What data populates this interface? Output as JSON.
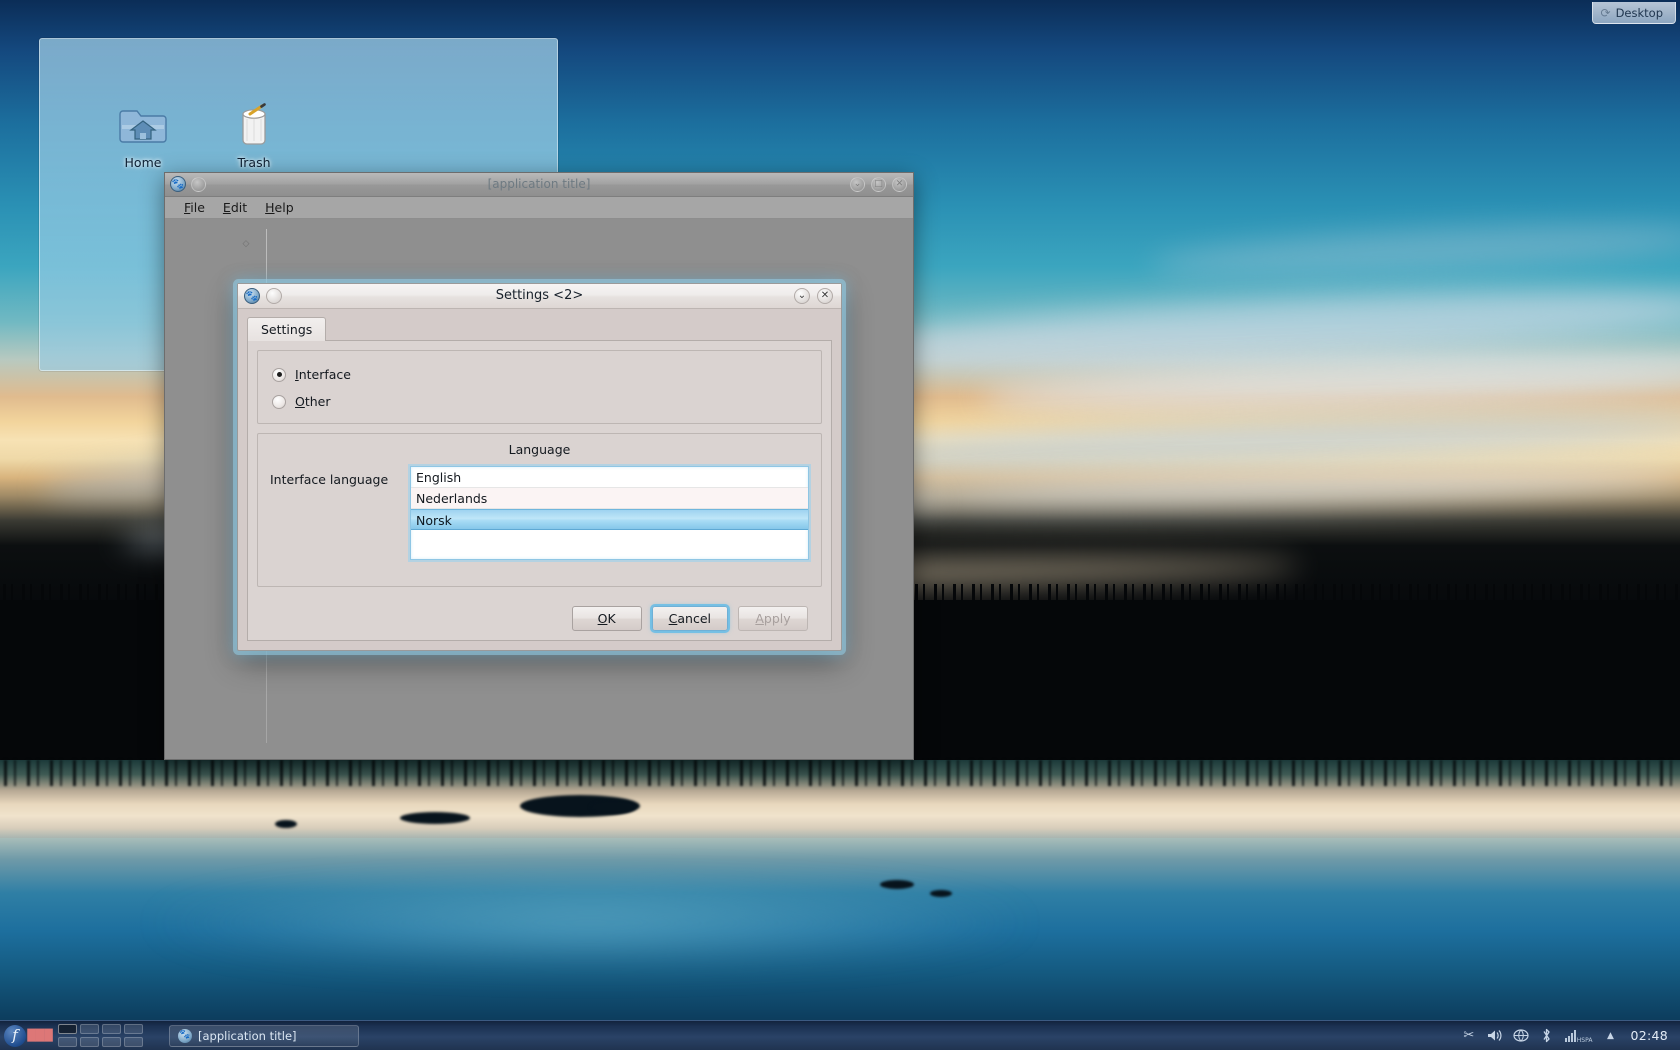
{
  "desktop": {
    "toolbox": {
      "label": "Desktop",
      "icon": "desktop-toolbox-icon"
    },
    "folderview": {
      "icons": [
        {
          "label": "Home",
          "icon": "home-folder-icon"
        },
        {
          "label": "Trash",
          "icon": "trash-icon"
        }
      ]
    }
  },
  "main_window": {
    "title": "[application title]",
    "app_icon": "paw-app-icon",
    "titlebar_buttons": [
      {
        "name": "sticky-button",
        "glyph": ""
      },
      {
        "name": "minimize-button",
        "glyph": "⌄"
      },
      {
        "name": "maximize-button",
        "glyph": "□"
      },
      {
        "name": "close-button",
        "glyph": "✕"
      }
    ],
    "menus": [
      {
        "mnemonic": "F",
        "rest": "ile"
      },
      {
        "mnemonic": "E",
        "rest": "dit"
      },
      {
        "mnemonic": "H",
        "rest": "elp"
      }
    ]
  },
  "dialog": {
    "title": "Settings <2>",
    "app_icon": "paw-app-icon",
    "titlebar_buttons": [
      {
        "name": "sticky-button",
        "glyph": ""
      },
      {
        "name": "shade-button",
        "glyph": "⌄"
      },
      {
        "name": "close-button",
        "glyph": "✕"
      }
    ],
    "tabs": [
      {
        "label": "Settings",
        "selected": true
      }
    ],
    "radios": [
      {
        "mnemonic": "I",
        "rest": "nterface",
        "label": "Interface",
        "selected": true
      },
      {
        "mnemonic": "O",
        "rest": "ther",
        "label": "Other",
        "selected": false
      }
    ],
    "language_group": {
      "legend": "Language",
      "field_label": "Interface language",
      "items": [
        {
          "label": "English",
          "selected": false
        },
        {
          "label": "Nederlands",
          "selected": false
        },
        {
          "label": "Norsk",
          "selected": true
        }
      ]
    },
    "buttons": [
      {
        "name": "ok",
        "mnemonic": "O",
        "pre": "",
        "rest": "K",
        "label": "OK",
        "state": "normal"
      },
      {
        "name": "cancel",
        "mnemonic": "C",
        "pre": "",
        "rest": "ancel",
        "label": "Cancel",
        "state": "focused"
      },
      {
        "name": "apply",
        "mnemonic": "A",
        "pre": "",
        "rest": "pply",
        "label": "Apply",
        "state": "disabled"
      }
    ]
  },
  "taskbar": {
    "launcher": {
      "name": "fedora-menu",
      "glyph": "f"
    },
    "pager": {
      "cells": 8,
      "active_index": 0
    },
    "task_button": {
      "label": "[application title]",
      "icon": "paw-app-icon"
    },
    "tray": [
      {
        "name": "klipper-scissors-icon",
        "glyph": "✂"
      },
      {
        "name": "volume-icon",
        "glyph": "🔊"
      },
      {
        "name": "network-icon",
        "glyph": "⌨"
      },
      {
        "name": "bluetooth-icon",
        "glyph": "ᛦ"
      },
      {
        "name": "hspa-signal-icon",
        "glyph": "HSPA"
      },
      {
        "name": "show-hidden-icon",
        "glyph": "▲"
      }
    ],
    "hspa_label": "HSPA",
    "clock": "02:48"
  },
  "colors": {
    "selection_blue": "#9ed3f0",
    "dialog_bg": "#d4cbc9",
    "window_bg": "#8f8f8f",
    "taskbar_bg": "#203350"
  }
}
